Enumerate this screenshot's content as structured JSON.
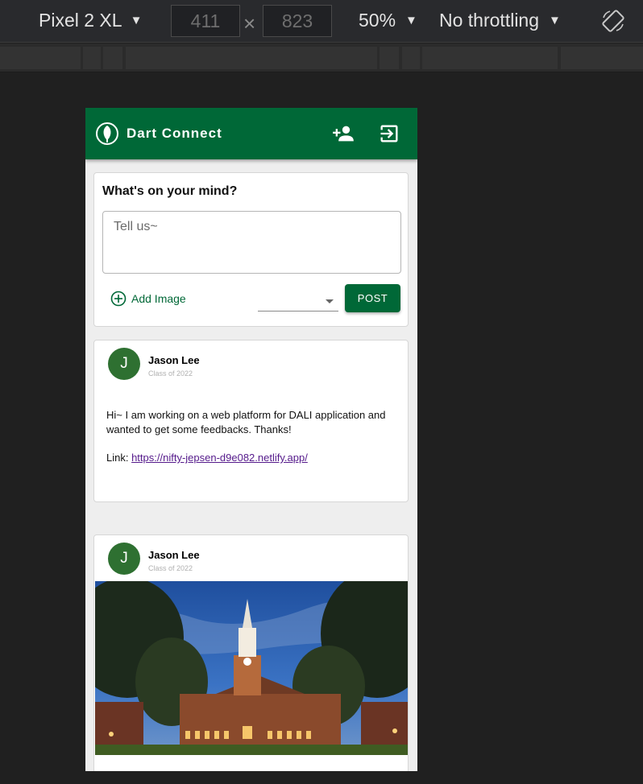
{
  "devtools": {
    "device": "Pixel 2 XL",
    "width": "411",
    "height": "823",
    "separator": "×",
    "zoom": "50%",
    "throttling": "No throttling"
  },
  "app": {
    "title": "Dart Connect",
    "brand_color": "#006837",
    "icons": [
      "tree-logo-icon",
      "add-friend-icon",
      "logout-icon"
    ]
  },
  "composer": {
    "title": "What's on your mind?",
    "placeholder": "Tell us~",
    "add_image_label": "Add Image",
    "select_value": "",
    "post_label": "POST"
  },
  "posts": [
    {
      "avatar_initial": "J",
      "author": "Jason Lee",
      "class_year": "Class of 2022",
      "body": "Hi~ I am working on a web platform for DALI application and wanted to get some feedbacks. Thanks!",
      "link_prefix": "Link: ",
      "link": "https://nifty-jepsen-d9e082.netlify.app/"
    },
    {
      "avatar_initial": "J",
      "author": "Jason Lee",
      "class_year": "Class of 2022"
    }
  ]
}
